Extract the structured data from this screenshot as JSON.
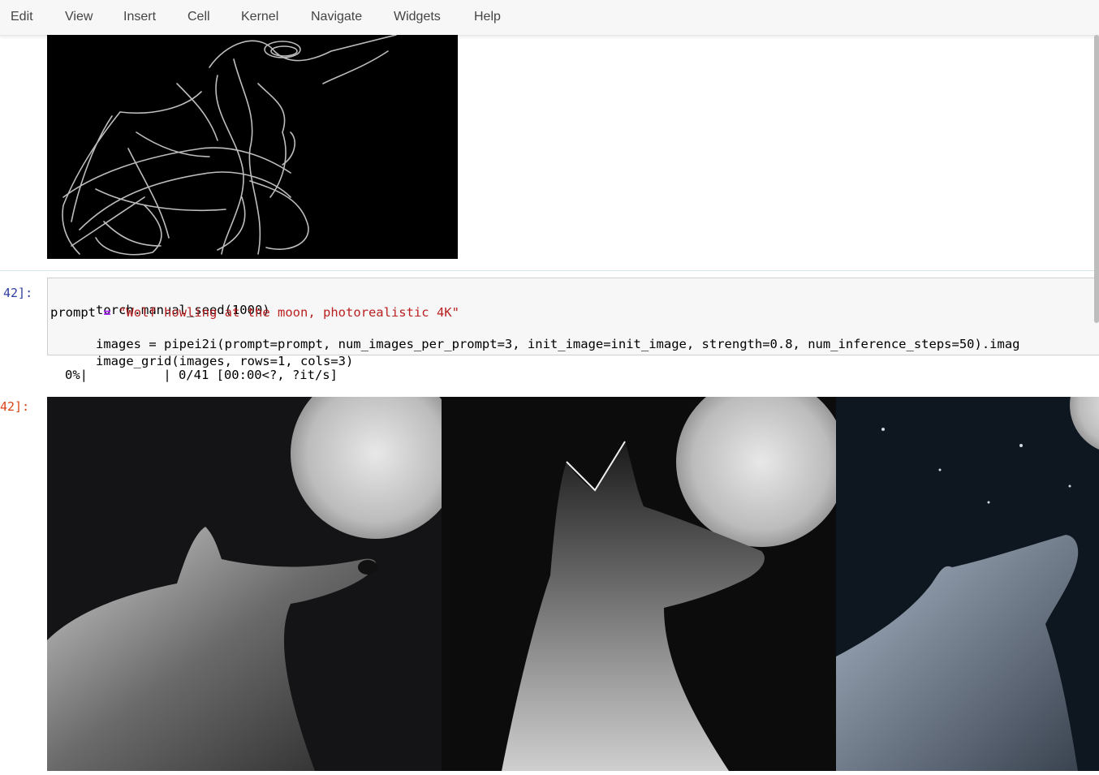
{
  "menu": {
    "items": [
      "Edit",
      "View",
      "Insert",
      "Cell",
      "Kernel",
      "Navigate",
      "Widgets",
      "Help"
    ]
  },
  "cell": {
    "in_prompt": "42]:",
    "out_prompt": "42]:",
    "code": {
      "line1": "torch.manual_seed(1000)",
      "line2_prompt_var": "prompt",
      "line2_string": "\"Wolf howling at the moon, photorealistic 4K\"",
      "line3": "images = pipei2i(prompt=prompt, num_images_per_prompt=3, init_image=init_image, strength=0.8, num_inference_steps=50).imag",
      "line4": "image_grid(images, rows=1, cols=3)"
    },
    "progress": "0%|          | 0/41 [00:00<?, ?it/s]"
  },
  "images": {
    "sketch": "sketch-drawing",
    "results": [
      "wolf-image-1",
      "wolf-image-2",
      "wolf-image-3"
    ]
  },
  "colors": {
    "menu_bg": "#f7f7f7",
    "prompt_blue": "#303f9f",
    "prompt_out": "#d84315",
    "string_red": "#ba2121",
    "number_green": "#008800",
    "operator_purple": "#aa22ff"
  }
}
